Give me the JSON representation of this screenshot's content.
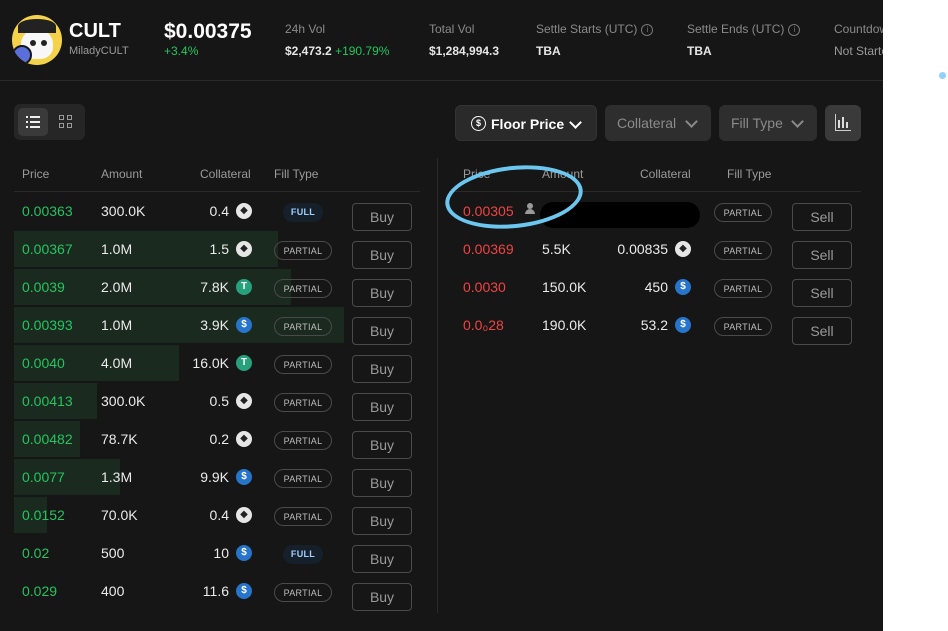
{
  "header": {
    "token_name": "CULT",
    "token_sub": "MiladyCULT",
    "price": "$0.00375",
    "price_change": "+3.4%",
    "stats": [
      {
        "label": "24h Vol",
        "value": "$2,473.2",
        "extra": "+190.79%"
      },
      {
        "label": "Total Vol",
        "value": "$1,284,994.3",
        "extra": ""
      },
      {
        "label": "Settle Starts (UTC)",
        "value": "TBA",
        "extra": ""
      },
      {
        "label": "Settle Ends (UTC)",
        "value": "TBA",
        "extra": ""
      },
      {
        "label": "Countdown",
        "value": "Not Started",
        "extra": ""
      }
    ]
  },
  "toolbar": {
    "floor_price": "Floor Price",
    "collateral": "Collateral",
    "fill_type": "Fill Type"
  },
  "buy_book": {
    "headers": [
      "Price",
      "Amount",
      "Collateral",
      "Fill Type"
    ],
    "action": "Buy",
    "rows": [
      {
        "price": "0.00363",
        "amount": "300.0K",
        "collateral": "0.4",
        "coin": "eth-icon",
        "fill": "FULL",
        "depth": 0
      },
      {
        "price": "0.00367",
        "amount": "1.0M",
        "collateral": "1.5",
        "coin": "eth-icon",
        "fill": "PARTIAL",
        "depth": 0.8
      },
      {
        "price": "0.0039",
        "amount": "2.0M",
        "collateral": "7.8K",
        "coin": "usdt-icon",
        "fill": "PARTIAL",
        "depth": 0.84
      },
      {
        "price": "0.00393",
        "amount": "1.0M",
        "collateral": "3.9K",
        "coin": "usdc-icon",
        "fill": "PARTIAL",
        "depth": 1
      },
      {
        "price": "0.0040",
        "amount": "4.0M",
        "collateral": "16.0K",
        "coin": "usdt-icon",
        "fill": "PARTIAL",
        "depth": 0.5
      },
      {
        "price": "0.00413",
        "amount": "300.0K",
        "collateral": "0.5",
        "coin": "eth-icon",
        "fill": "PARTIAL",
        "depth": 0.25
      },
      {
        "price": "0.00482",
        "amount": "78.7K",
        "collateral": "0.2",
        "coin": "eth-icon",
        "fill": "PARTIAL",
        "depth": 0.2
      },
      {
        "price": "0.0077",
        "amount": "1.3M",
        "collateral": "9.9K",
        "coin": "usdc-icon",
        "fill": "PARTIAL",
        "depth": 0.32
      },
      {
        "price": "0.0152",
        "amount": "70.0K",
        "collateral": "0.4",
        "coin": "eth-icon",
        "fill": "PARTIAL",
        "depth": 0.1
      },
      {
        "price": "0.02",
        "amount": "500",
        "collateral": "10",
        "coin": "usdc-icon",
        "fill": "FULL",
        "depth": 0
      },
      {
        "price": "0.029",
        "amount": "400",
        "collateral": "11.6",
        "coin": "usdc-icon",
        "fill": "PARTIAL",
        "depth": 0
      }
    ]
  },
  "sell_book": {
    "headers": [
      "Price",
      "Amount",
      "Collateral",
      "Fill Type"
    ],
    "action": "Sell",
    "rows": [
      {
        "price": "0.00305",
        "amount": "",
        "collateral": "",
        "coin": "",
        "fill": "PARTIAL",
        "own": true
      },
      {
        "price": "0.00369",
        "amount": "5.5K",
        "collateral": "0.00835",
        "coin": "eth-icon",
        "fill": "PARTIAL",
        "own": false
      },
      {
        "price": "0.0030",
        "amount": "150.0K",
        "collateral": "450",
        "coin": "usdc-icon",
        "fill": "PARTIAL",
        "own": false
      },
      {
        "price": "0.0₀28",
        "amount": "190.0K",
        "collateral": "53.2",
        "coin": "usdc-icon",
        "fill": "PARTIAL",
        "own": false
      }
    ]
  },
  "colors": {
    "positive": "#22c55e",
    "negative": "#ef4444",
    "background": "#161616",
    "annotation": "#6cc7f0"
  }
}
